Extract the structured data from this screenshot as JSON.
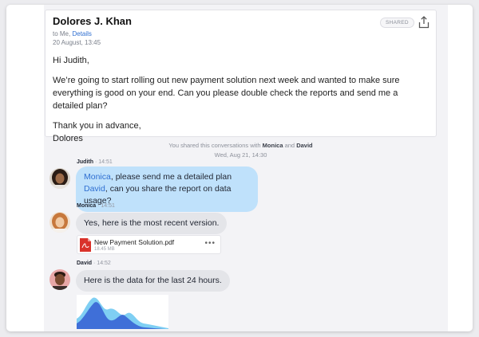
{
  "email": {
    "sender": "Dolores J. Khan",
    "recipients_prefix": "to Me,",
    "details_link": "Details",
    "date": "20 August, 13:45",
    "badge": "SHARED",
    "share_icon": "share-upload-icon",
    "greeting": "Hi Judith,",
    "paragraph": "We’re going to start rolling out new payment solution next week and wanted to make sure everything is good on your end. Can you please double check the reports and send me a detailed plan?",
    "closing": "Thank you in advance,",
    "signature": "Dolores"
  },
  "notice": {
    "prefix": "You shared this conversations with",
    "name1": "Monica",
    "and": "and",
    "name2": "David",
    "date": "Wed, Aug 21, 14:30"
  },
  "messages": [
    {
      "author": "Judith",
      "time": "14:51",
      "mention1": "Monica",
      "text1": ", please send me a detailed plan",
      "mention2": "David",
      "text2": ", can you share the report on data usage?"
    },
    {
      "author": "Monica",
      "time": "14:51",
      "text": "Yes, here is the most recent version."
    },
    {
      "author": "David",
      "time": "14:52",
      "text": "Here is the data for the last 24 hours."
    }
  ],
  "attachment": {
    "name": "New Payment Solution.pdf",
    "size": "18.45 MB",
    "icon": "pdf-file-icon",
    "more": "•••"
  },
  "colors": {
    "accent": "#2f6fd1",
    "bubble_blue": "#bfe1fb",
    "bubble_gray": "#e4e5e9",
    "chart_dark": "#3f6fd8",
    "chart_light": "#7fcff3"
  }
}
